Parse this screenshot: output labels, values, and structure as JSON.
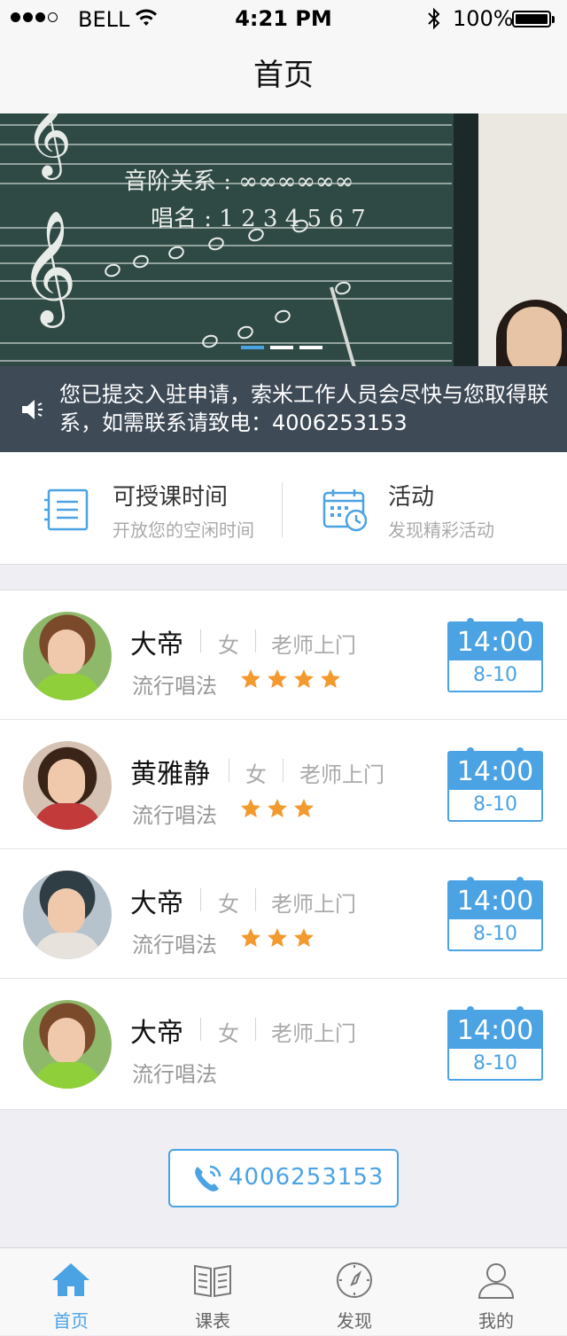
{
  "status_bar": {
    "carrier": "BELL",
    "time": "4:21 PM",
    "battery": "100%",
    "icons": [
      "signal-dots",
      "wifi-icon",
      "bluetooth-icon",
      "battery-icon"
    ]
  },
  "nav": {
    "title": "首页"
  },
  "banner": {
    "page_count": 3,
    "active_index": 0,
    "image": "teacher at music chalkboard"
  },
  "notice": {
    "icon": "speaker-icon",
    "text": "您已提交入驻申请，索米工作人员会尽快与您取得联系，如需联系请致电：4006253153"
  },
  "quick_actions": [
    {
      "title": "可授课时间",
      "subtitle": "开放您的空闲时间",
      "icon": "list-icon"
    },
    {
      "title": "活动",
      "subtitle": "发现精彩活动",
      "icon": "calendar-clock-icon"
    }
  ],
  "teachers": [
    {
      "name": "大帝",
      "gender": "女",
      "mode": "老师上门",
      "skill": "流行唱法",
      "rating": 4,
      "time": "14:00",
      "range": "8-10"
    },
    {
      "name": "黄雅静",
      "gender": "女",
      "mode": "老师上门",
      "skill": "流行唱法",
      "rating": 3,
      "time": "14:00",
      "range": "8-10"
    },
    {
      "name": "大帝",
      "gender": "女",
      "mode": "老师上门",
      "skill": "流行唱法",
      "rating": 3,
      "time": "14:00",
      "range": "8-10"
    },
    {
      "name": "大帝",
      "gender": "女",
      "mode": "老师上门",
      "skill": "流行唱法",
      "rating": 0,
      "time": "14:00",
      "range": "8-10"
    }
  ],
  "call": {
    "phone": "4006253153",
    "icon": "phone-icon"
  },
  "tabs": [
    {
      "label": "首页",
      "icon": "home-icon",
      "active": true
    },
    {
      "label": "课表",
      "icon": "book-icon",
      "active": false
    },
    {
      "label": "发现",
      "icon": "compass-icon",
      "active": false
    },
    {
      "label": "我的",
      "icon": "person-icon",
      "active": false
    }
  ],
  "colors": {
    "accent": "#4ba3e4",
    "star": "#f39a2f",
    "notice_bg": "#3f4a57"
  }
}
